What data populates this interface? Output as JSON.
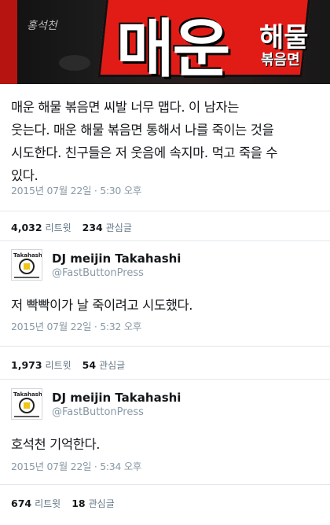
{
  "banner": {
    "hangul_big": "매운",
    "hangul_side": "해물",
    "hangul_small": "볶음면"
  },
  "tweet1": {
    "lines": [
      "매운 해물 볶음면 씨발 너무 맵다. 이 남자는",
      "웃는다. 매운 해물 볶음면 통해서 나를 죽이는 것을",
      "시도한다. 친구들은 저 웃음에 속지마. 먹고 죽을 수",
      "있다."
    ],
    "timestamp": "2015년 07월 22일 · 5:30 오후",
    "retweets": "4,032",
    "retweets_label": "리트윗",
    "likes": "234",
    "likes_label": "관심글"
  },
  "reply1": {
    "avatar_text": "Takahashi",
    "name": "DJ meijin Takahashi",
    "handle": "@FastButtonPress",
    "text": "저 빡빡이가 날 죽이려고 시도했다.",
    "timestamp": "2015년 07월 22일 · 5:32 오후",
    "retweets": "1,973",
    "retweets_label": "리트윗",
    "likes": "54",
    "likes_label": "관심글"
  },
  "reply2": {
    "avatar_text": "Takahashi",
    "name": "DJ meijin Takahashi",
    "handle": "@FastButtonPress",
    "text": "호석천 기억한다.",
    "timestamp": "2015년 07월 22일 · 5:34 오후",
    "retweets": "674",
    "retweets_label": "리트윗",
    "likes": "18",
    "likes_label": "관심글"
  }
}
